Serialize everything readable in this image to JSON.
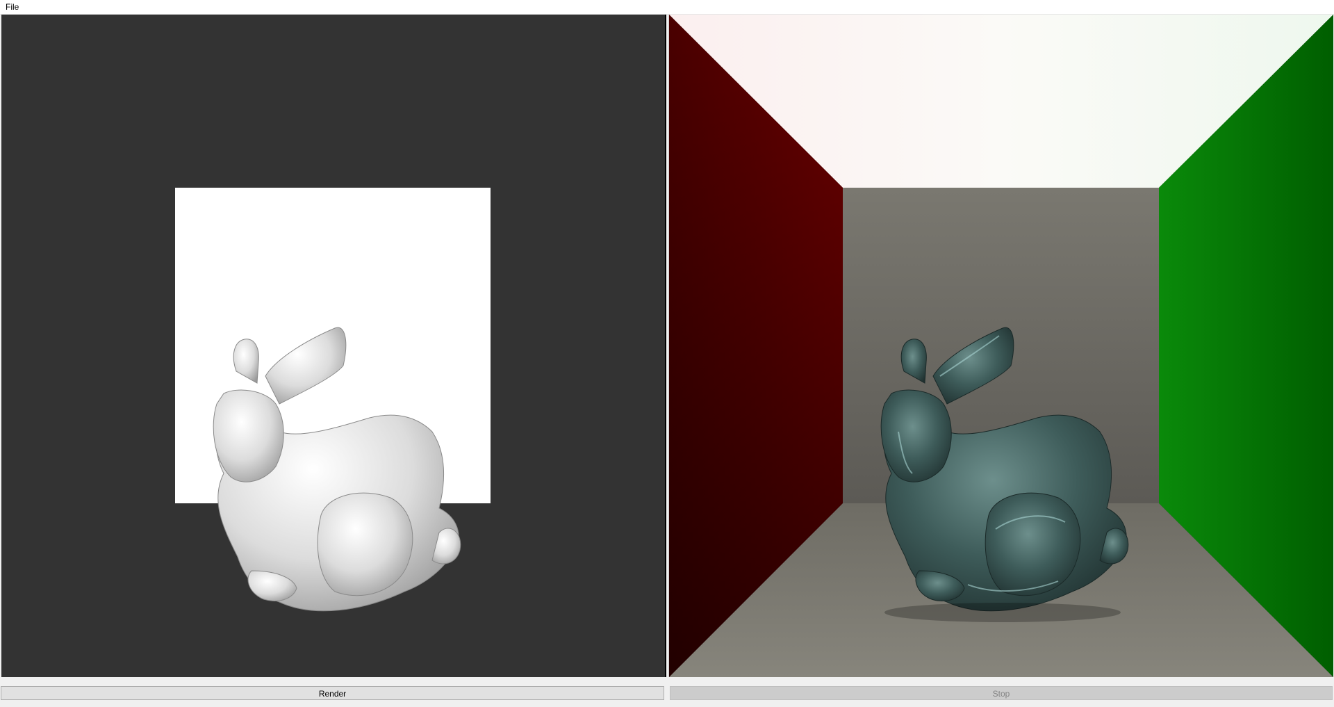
{
  "menu": {
    "file_label": "File"
  },
  "viewports": {
    "preview": {
      "background": "#333333",
      "light_panel_color": "#ffffff",
      "model_color": "#e8e8e8"
    },
    "render": {
      "left_wall_color": "#5a0000",
      "right_wall_color": "#007000",
      "back_wall_color": "#6a6860",
      "floor_color": "#7a786e",
      "ceiling_color": "#f7f5f2",
      "model_color": "#3b5a57"
    }
  },
  "controls": {
    "render_label": "Render",
    "stop_label": "Stop"
  }
}
